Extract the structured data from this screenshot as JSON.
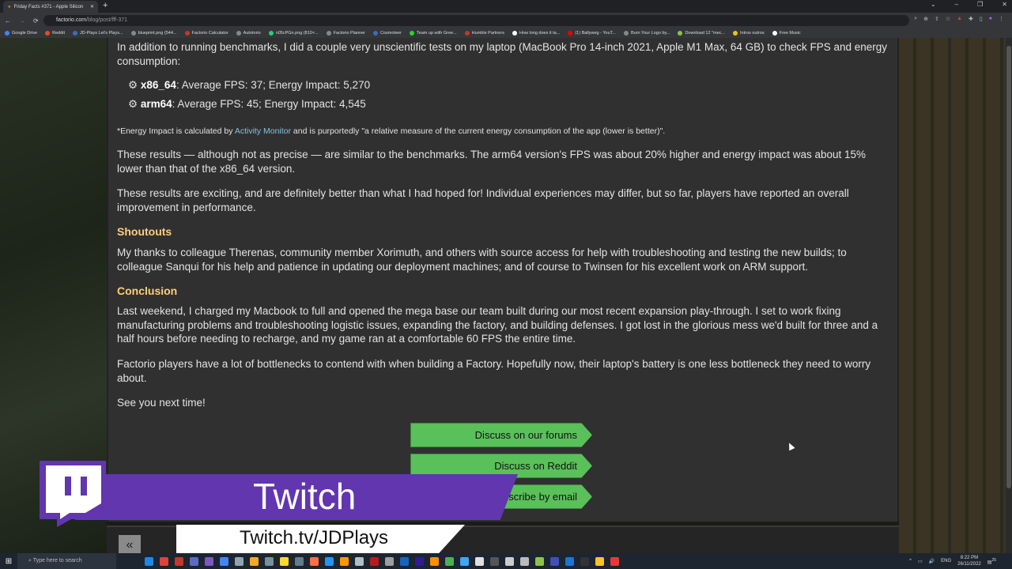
{
  "browser": {
    "tab_title": "Friday Facts #371 - Apple Silicon",
    "url_domain": "factorio.com",
    "url_path": "/blog/post/fff-371",
    "bookmarks": [
      "Google Drive",
      "Reddit",
      "JD-Plays Let's Plays...",
      "blueprint.png (544...",
      "Factorio Calculator",
      "Autotorio",
      "n05cPGn.png (810×...",
      "Factorio Planner",
      "Cosmoteer",
      "Team up with Gree...",
      "Humble Partners",
      "How long does it ta...",
      "(1) Ballyweg - YouT...",
      "Burn Your Logo by...",
      "Download 12 \"mec...",
      "Intros outros",
      "Free Music"
    ],
    "bookmark_colors": [
      "#4285f4",
      "#e34c26",
      "#3b6fb6",
      "#888",
      "#c0392b",
      "#888",
      "#2ecc71",
      "#888",
      "#3b6fb6",
      "#27d827",
      "#c0392b",
      "#fff",
      "#e00",
      "#888",
      "#8bc34a",
      "#f1c40f",
      "#fff"
    ]
  },
  "article": {
    "intro": "In addition to running benchmarks, I did a couple very unscientific tests on my laptop (MacBook Pro 14-inch 2021, Apple M1 Max, 64 GB) to check FPS and energy consumption:",
    "bullets": [
      {
        "label": "x86_64",
        "text": ": Average FPS: 37; Energy Impact: 5,270"
      },
      {
        "label": "arm64",
        "text": ": Average FPS: 45; Energy Impact: 4,545"
      }
    ],
    "note_pre": "*Energy Impact is calculated by ",
    "note_link": "Activity Monitor",
    "note_post": " and is purportedly \"a relative measure of the current energy consumption of the app (lower is better)\".",
    "p1": "These results — although not as precise — are similar to the benchmarks. The arm64 version's FPS was about 20% higher and energy impact was about 15% lower than that of the x86_64 version.",
    "p2": "These results are exciting, and are definitely better than what I had hoped for! Individual experiences may differ, but so far, players have reported an overall improvement in performance.",
    "h_shoutouts": "Shoutouts",
    "p3": "My thanks to colleague Therenas, community member Xorimuth, and others with source access for help with troubleshooting and testing the new builds; to colleague Sanqui for his help and patience in updating our deployment machines; and of course to Twinsen for his excellent work on ARM support.",
    "h_conclusion": "Conclusion",
    "p4": "Last weekend, I charged my Macbook to full and opened the mega base our team built during our most recent expansion play-through. I set to work fixing manufacturing problems and troubleshooting logistic issues, expanding the factory, and building defenses. I got lost in the glorious mess we'd built for three and a half hours before needing to recharge, and my game ran at a comfortable 60 FPS the entire time.",
    "p5": "Factorio players have a lot of bottlenecks to contend with when building a Factory. Hopefully now, their laptop's battery is one less bottleneck they need to worry about.",
    "p6": "See you next time!",
    "buttons": {
      "forums": "Discuss on our forums",
      "reddit": "Discuss on Reddit",
      "email": "Subscribe by email"
    },
    "back": "«"
  },
  "overlay": {
    "brand": "Twitch",
    "url": "Twitch.tv/JDPlays",
    "color": "#6236ae"
  },
  "taskbar": {
    "search_placeholder": "Type here to search",
    "lang": "ENG",
    "time": "8:22 PM",
    "date": "26/11/2022",
    "notif_count": "25"
  },
  "colors": {
    "heading": "#ffcf7a",
    "link": "#7fc6dc",
    "button": "#5ac05a",
    "panel": "#313031"
  }
}
